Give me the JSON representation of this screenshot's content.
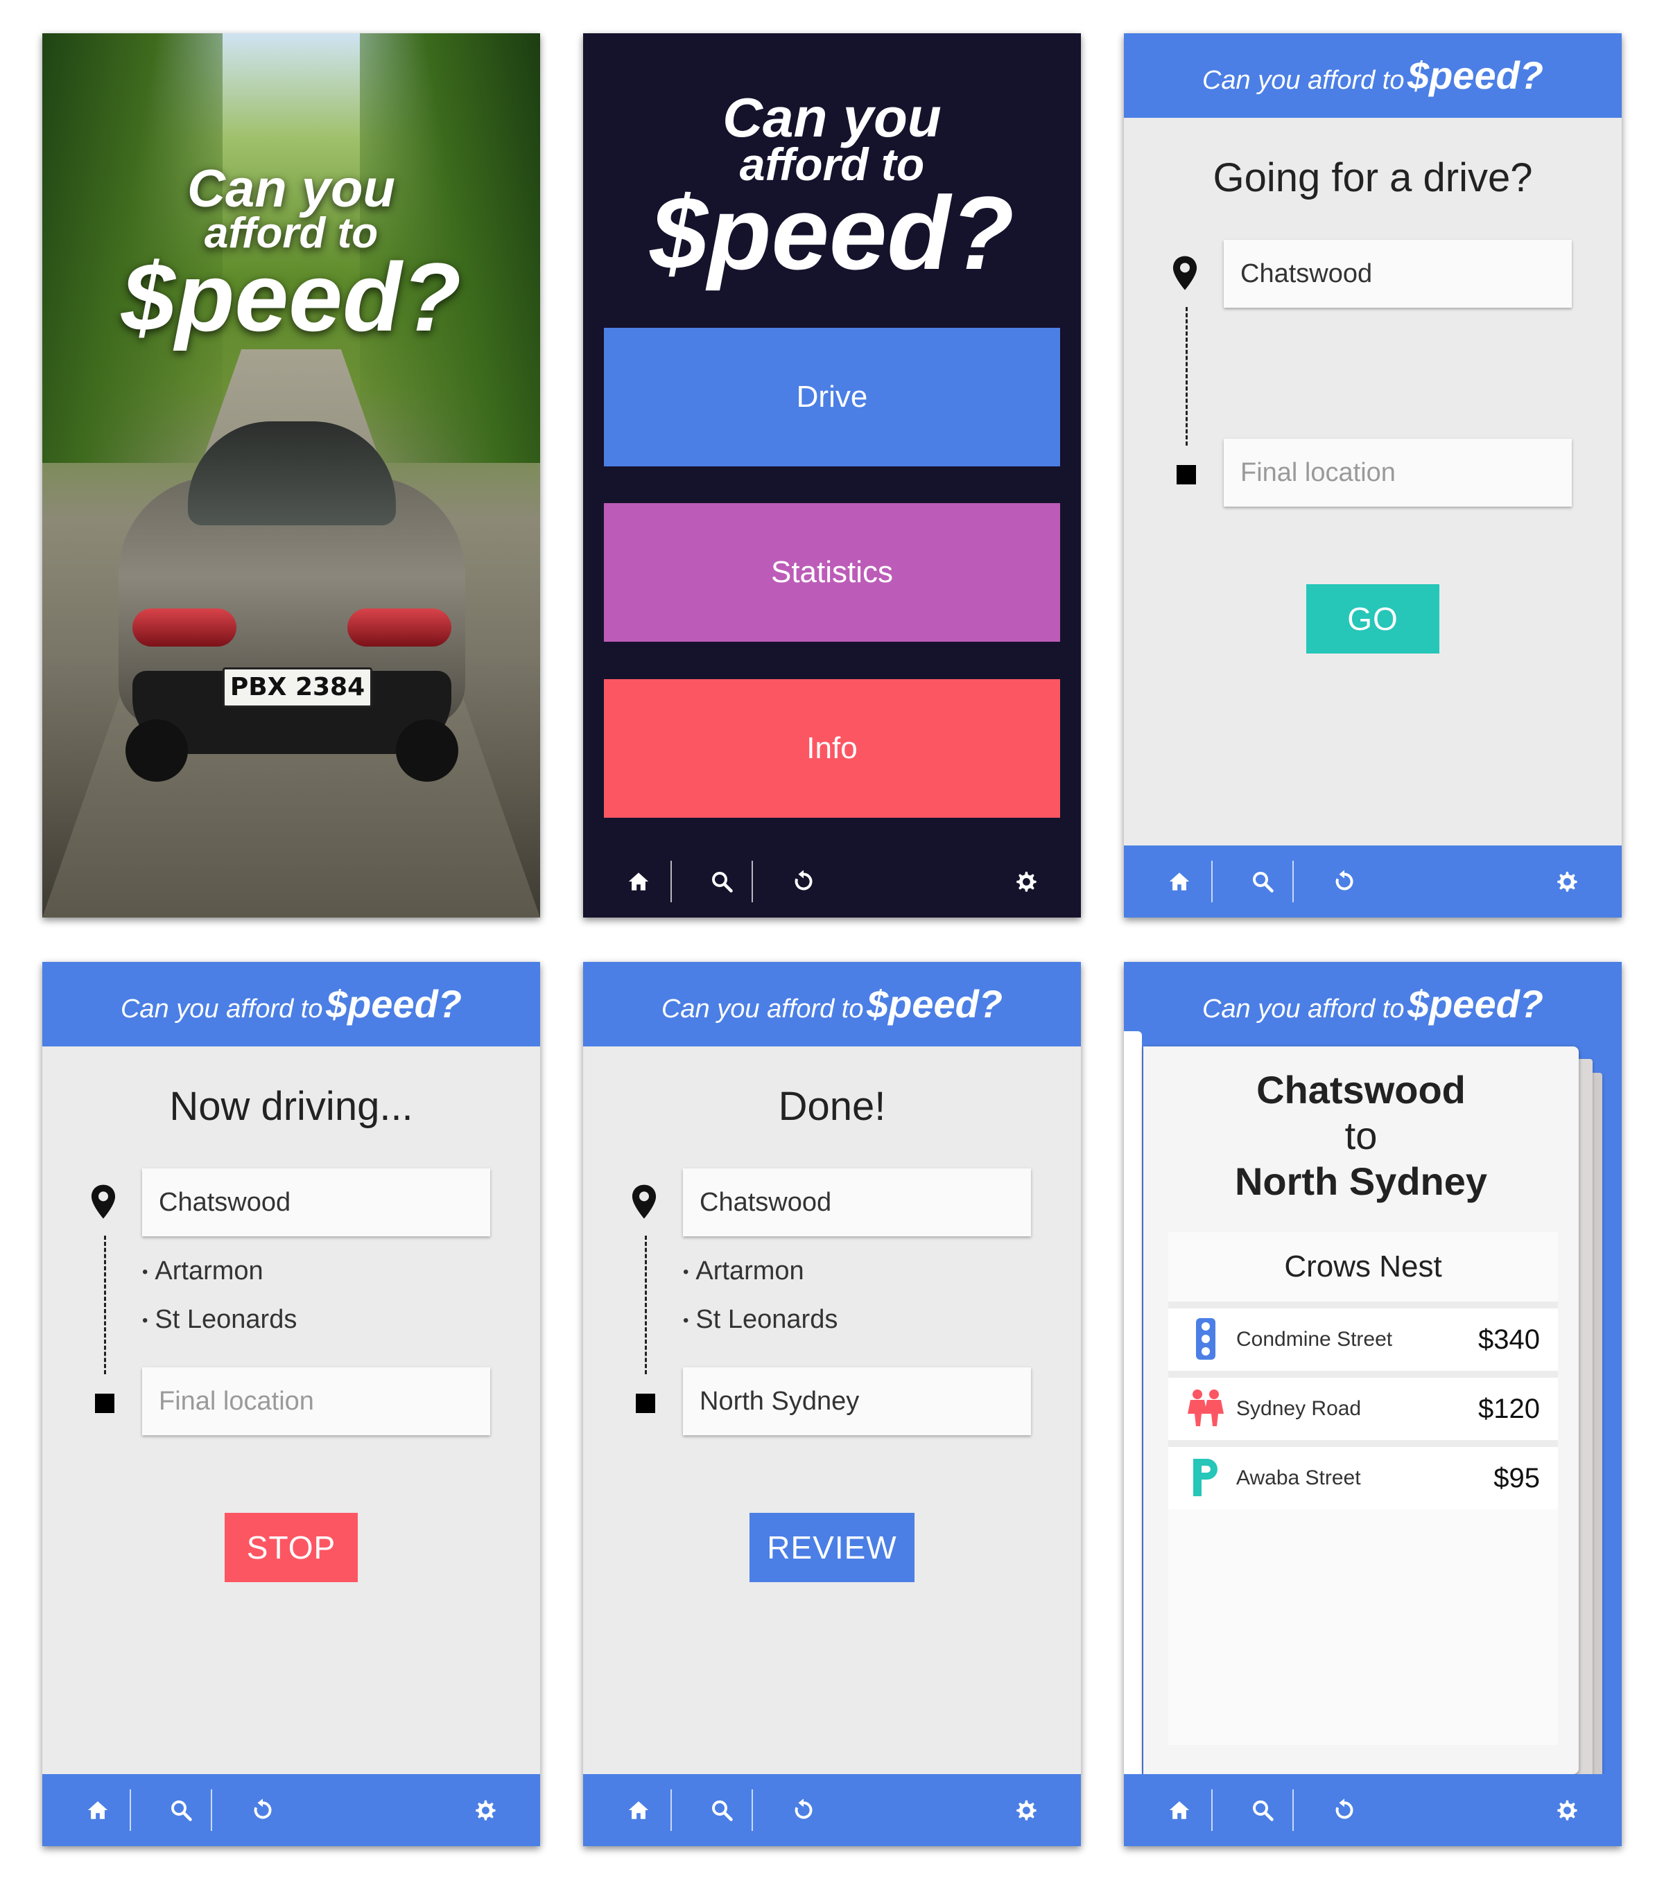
{
  "brand": {
    "line1": "Can you",
    "line2": "afford to",
    "line3": "$peed?",
    "header_a": "Can you afford to",
    "header_b": "$peed?"
  },
  "splash": {
    "plate": "PBX 2384"
  },
  "menu": {
    "drive": "Drive",
    "statistics": "Statistics",
    "info": "Info"
  },
  "drive": {
    "title": "Going for a drive?",
    "start": "Chatswood",
    "end_placeholder": "Final location",
    "go": "GO"
  },
  "driving": {
    "title": "Now driving...",
    "start": "Chatswood",
    "stops": [
      "Artarmon",
      "St Leonards"
    ],
    "end_placeholder": "Final location",
    "stop": "STOP"
  },
  "done": {
    "title": "Done!",
    "start": "Chatswood",
    "stops": [
      "Artarmon",
      "St Leonards"
    ],
    "end": "North Sydney",
    "review": "REVIEW"
  },
  "review": {
    "from": "Chatswood",
    "to_word": "to",
    "to": "North Sydney",
    "suburb": "Crows Nest",
    "fines": [
      {
        "icon": "traffic-light-icon",
        "street": "Condmine Street",
        "amount": "$340"
      },
      {
        "icon": "school-zone-icon",
        "street": "Sydney Road",
        "amount": "$120"
      },
      {
        "icon": "parking-icon",
        "street": "Awaba Street",
        "amount": "$95"
      }
    ]
  },
  "nav": {
    "items": [
      "home-icon",
      "search-icon",
      "reset-icon",
      "gear-icon"
    ]
  },
  "colors": {
    "blue": "#4b7fe5",
    "purple": "#bc5cb8",
    "red": "#fd5663",
    "teal": "#26c6b9",
    "dark": "#15122c",
    "grey": "#ebebeb"
  }
}
